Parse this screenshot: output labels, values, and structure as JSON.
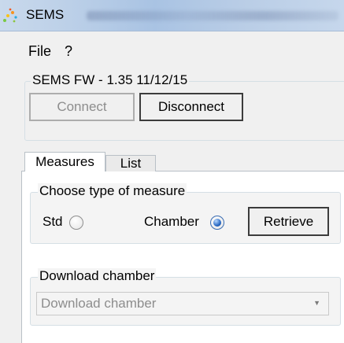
{
  "window": {
    "title": "SEMS",
    "icon": "sparkle-app-icon"
  },
  "menu": {
    "items": [
      "File",
      "?"
    ]
  },
  "firmware_group": {
    "legend": "SEMS FW - 1.35 11/12/15",
    "connect_label": "Connect",
    "disconnect_label": "Disconnect"
  },
  "tabs": [
    {
      "label": "Measures",
      "active": true
    },
    {
      "label": "List",
      "active": false
    }
  ],
  "measure_group": {
    "legend": "Choose type of measure",
    "std_label": "Std",
    "std_checked": false,
    "chamber_label": "Chamber",
    "chamber_checked": true,
    "retrieve_label": "Retrieve"
  },
  "download_group": {
    "legend": "Download chamber",
    "combo_value": "Download chamber",
    "combo_enabled": false
  },
  "colors": {
    "title_gradient": "#a9c3e3",
    "radio_selected": "#2a6ac4",
    "disabled_text": "#8d8d8d"
  }
}
